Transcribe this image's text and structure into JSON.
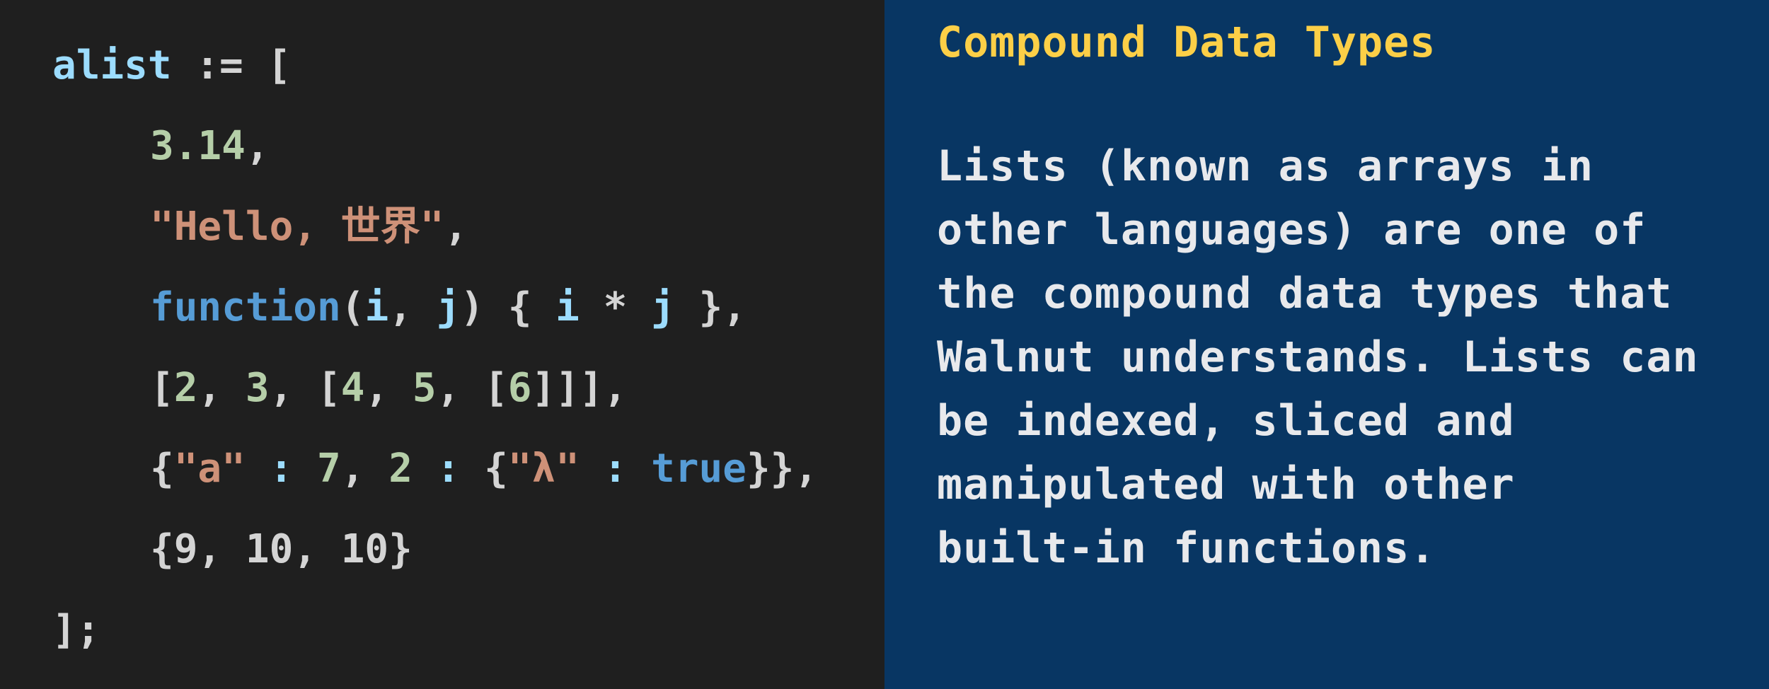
{
  "code": {
    "language": "Walnut",
    "colors": {
      "background": "#1f1f1f",
      "variable": "#9cdcfe",
      "punctuation": "#d4d4d4",
      "number": "#b5cea8",
      "string": "#ce9178",
      "keyword": "#569cd6"
    },
    "lines": [
      {
        "indent": false,
        "tokens": [
          {
            "t": "alist",
            "k": "var"
          },
          {
            "t": " := [",
            "k": "punct"
          }
        ]
      },
      {
        "indent": true,
        "tokens": [
          {
            "t": "3.14",
            "k": "num"
          },
          {
            "t": ",",
            "k": "punct"
          }
        ]
      },
      {
        "indent": true,
        "tokens": [
          {
            "t": "\"Hello, 世界\"",
            "k": "str"
          },
          {
            "t": ",",
            "k": "punct"
          }
        ]
      },
      {
        "indent": true,
        "tokens": [
          {
            "t": "function",
            "k": "kw"
          },
          {
            "t": "(",
            "k": "punct"
          },
          {
            "t": "i",
            "k": "var"
          },
          {
            "t": ", ",
            "k": "punct"
          },
          {
            "t": "j",
            "k": "var"
          },
          {
            "t": ") { ",
            "k": "punct"
          },
          {
            "t": "i",
            "k": "var"
          },
          {
            "t": " * ",
            "k": "punct"
          },
          {
            "t": "j",
            "k": "var"
          },
          {
            "t": " },",
            "k": "punct"
          }
        ]
      },
      {
        "indent": true,
        "tokens": [
          {
            "t": "[",
            "k": "punct"
          },
          {
            "t": "2",
            "k": "num"
          },
          {
            "t": ", ",
            "k": "punct"
          },
          {
            "t": "3",
            "k": "num"
          },
          {
            "t": ", [",
            "k": "punct"
          },
          {
            "t": "4",
            "k": "num"
          },
          {
            "t": ", ",
            "k": "punct"
          },
          {
            "t": "5",
            "k": "num"
          },
          {
            "t": ", [",
            "k": "punct"
          },
          {
            "t": "6",
            "k": "num"
          },
          {
            "t": "]]],",
            "k": "punct"
          }
        ]
      },
      {
        "indent": true,
        "tokens": [
          {
            "t": "{",
            "k": "punct"
          },
          {
            "t": "\"a\"",
            "k": "str"
          },
          {
            "t": " : ",
            "k": "var"
          },
          {
            "t": "7",
            "k": "num"
          },
          {
            "t": ", ",
            "k": "punct"
          },
          {
            "t": "2",
            "k": "num"
          },
          {
            "t": " : ",
            "k": "var"
          },
          {
            "t": "{",
            "k": "punct"
          },
          {
            "t": "\"λ\"",
            "k": "str"
          },
          {
            "t": " : ",
            "k": "var"
          },
          {
            "t": "true",
            "k": "kw"
          },
          {
            "t": "}},",
            "k": "punct"
          }
        ]
      },
      {
        "indent": true,
        "tokens": [
          {
            "t": "{9, 10, 10}",
            "k": "punct"
          }
        ]
      },
      {
        "indent": false,
        "tokens": [
          {
            "t": "];",
            "k": "punct"
          }
        ]
      }
    ]
  },
  "description": {
    "background": "#083663",
    "title_color": "#fccf47",
    "text_color": "#e8e9ec",
    "title": "Compound Data Types",
    "body": "Lists (known as arrays in\nother languages) are one of\nthe compound data types that\nWalnut understands. Lists can\nbe indexed, sliced and\nmanipulated with other\nbuilt-in functions."
  }
}
